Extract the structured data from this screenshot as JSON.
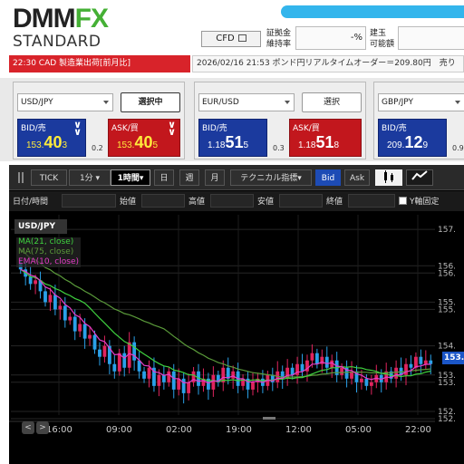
{
  "header": {
    "logo_dmm": "DMM",
    "logo_fx": "FX",
    "logo_sub": "STANDARD",
    "cfd_label": "CFD",
    "margin_label_1": "証拠金",
    "margin_label_2": "維持率",
    "margin_value": "-%",
    "balance_label_1": "建玉",
    "balance_label_2": "可能額",
    "balance_value": ""
  },
  "news": {
    "headline": "22:30  CAD  製造業出荷[前月比]",
    "ticker": "2026/02/16 21:53 ポンド円リアルタイムオーダー＝209.80円　売り"
  },
  "panels": [
    {
      "pair": "USD/JPY",
      "button": "選択中",
      "active": true,
      "bid_label": "BID/売",
      "ask_label": "ASK/買",
      "bid_small": "153.",
      "bid_big": "40",
      "bid_tail": "3",
      "ask_small": "153.",
      "ask_big": "40",
      "ask_tail": "5",
      "spread": "0.2",
      "bid_yellow": true
    },
    {
      "pair": "EUR/USD",
      "button": "選択",
      "active": false,
      "bid_label": "BID/売",
      "ask_label": "ASK/買",
      "bid_small": "1.18",
      "bid_big": "51",
      "bid_tail": "5",
      "ask_small": "1.18",
      "ask_big": "51",
      "ask_tail": "8",
      "spread": "0.3",
      "bid_yellow": false
    },
    {
      "pair": "GBP/JPY",
      "button": "",
      "active": false,
      "bid_label": "BID/売",
      "ask_label": "",
      "bid_small": "209.",
      "bid_big": "12",
      "bid_tail": "9",
      "ask_small": "",
      "ask_big": "",
      "ask_tail": "",
      "spread": "0.9",
      "bid_yellow": false
    }
  ],
  "toolbar": {
    "tick": "TICK",
    "tf_1m": "1分",
    "tf_1h": "1時間",
    "tf_day": "日",
    "tf_week": "週",
    "tf_month": "月",
    "indicators": "テクニカル指標",
    "bid": "Bid",
    "ask": "Ask"
  },
  "filter": {
    "datetime": "日付/時間",
    "open": "始値",
    "high": "高値",
    "low": "安値",
    "close": "終値",
    "yfix": "Y軸固定"
  },
  "chart": {
    "symbol": "USD/JPY",
    "legend": [
      {
        "text": "MA(21, close)",
        "color": "#3fd23f"
      },
      {
        "text": "MA(75, close)",
        "color": "#5a9a3a"
      },
      {
        "text": "EMA(10, close)",
        "color": "#e63cc8"
      }
    ],
    "price_tag": "153.",
    "nav_prev": "<",
    "nav_next": ">"
  },
  "chart_data": {
    "type": "candlestick",
    "title": "USD/JPY",
    "x_ticks": [
      "16:00",
      "09:00",
      "02:00",
      "19:00",
      "12:00",
      "05:00",
      "22:00"
    ],
    "y_ticks": [
      157,
      156,
      156,
      155,
      155,
      154,
      153,
      153,
      152,
      152
    ],
    "y_tick_labels": [
      "157.",
      "156.",
      "156.",
      "155.",
      "155.",
      "154.",
      "153.",
      "153.",
      "152.",
      "152."
    ],
    "ylim": [
      151.9,
      157.4
    ],
    "close_series": [
      155.9,
      155.7,
      155.5,
      155.6,
      155.3,
      155.0,
      155.2,
      154.8,
      154.9,
      154.5,
      154.6,
      154.2,
      154.4,
      154.0,
      154.1,
      153.7,
      153.5,
      153.8,
      153.3,
      153.1,
      153.6,
      153.2,
      153.9,
      153.4,
      153.1,
      152.9,
      153.2,
      152.7,
      153.0,
      152.8,
      153.1,
      152.6,
      152.9,
      152.5,
      152.8,
      153.1,
      152.7,
      152.9,
      152.6,
      153.0,
      152.8,
      153.2,
      152.9,
      153.1,
      152.7,
      152.9,
      152.6,
      152.8,
      152.9,
      152.7,
      153.0,
      152.8,
      153.1,
      152.9,
      153.2,
      153.0,
      153.3,
      153.1,
      153.4,
      153.6,
      153.3,
      153.5,
      153.2,
      153.4,
      153.0,
      153.2,
      152.9,
      153.1,
      152.8,
      152.9,
      152.7,
      152.8,
      153.0,
      152.8,
      153.1,
      152.9,
      153.2,
      153.0,
      153.3,
      153.2,
      153.5,
      153.3,
      153.4,
      153.3
    ],
    "ma21_color": "#3fd23f",
    "ma75_color": "#5a9a3a",
    "ema10_color": "#e63cc8",
    "up_color": "#e0245e",
    "down_color": "#2aa0e8"
  }
}
